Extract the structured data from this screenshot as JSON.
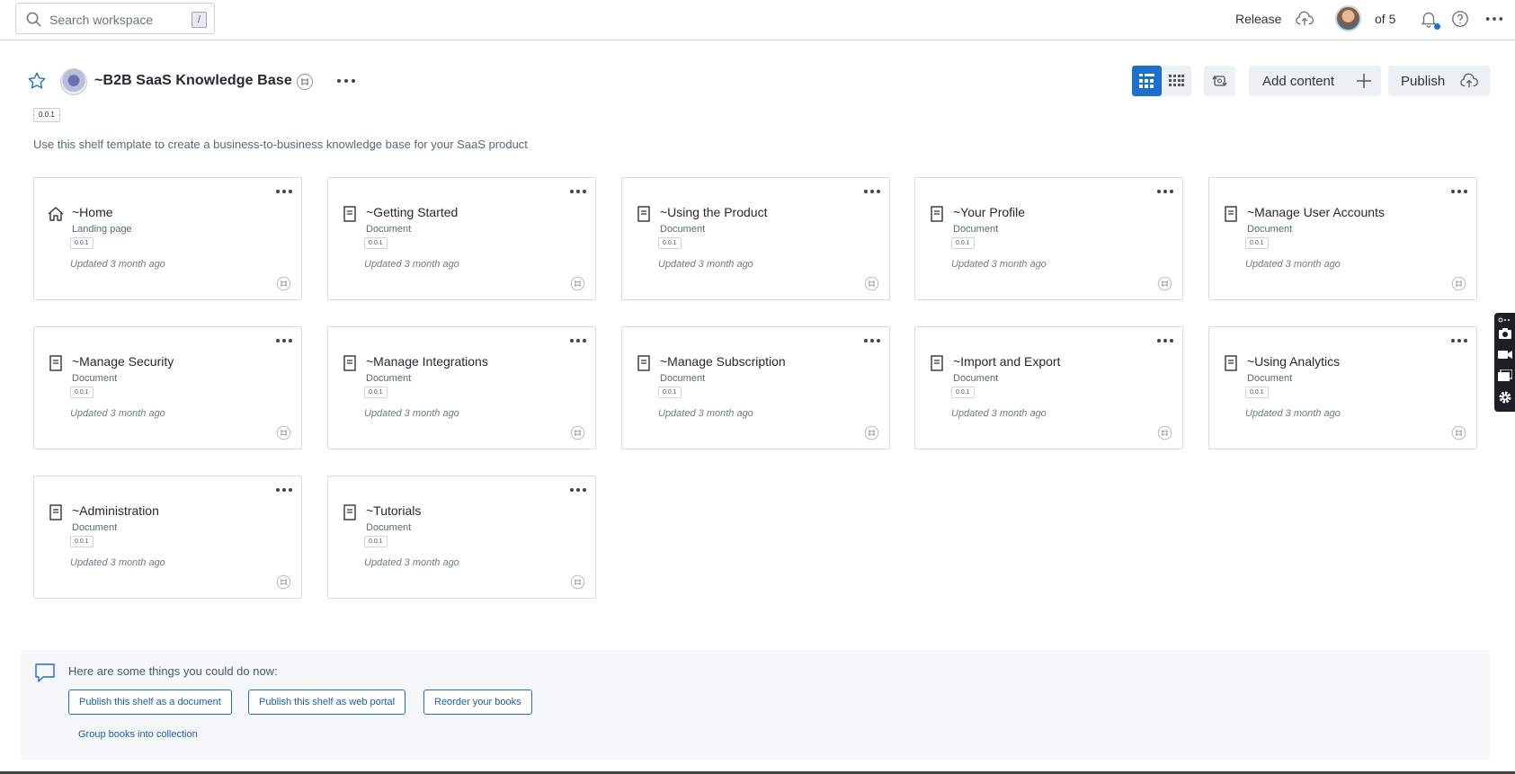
{
  "topbar": {
    "search_placeholder": "Search workspace",
    "search_shortcut": "/",
    "release_label": "Release",
    "of_label": "of 5"
  },
  "header": {
    "title": "~B2B SaaS Knowledge Base",
    "version": "0.0.1",
    "description": "Use this shelf template to create a business-to-business knowledge base for your SaaS product",
    "add_content_label": "Add content",
    "publish_label": "Publish"
  },
  "cards": [
    {
      "title": "~Home",
      "type": "Landing page",
      "version": "0.0.1",
      "updated": "Updated 3 month ago",
      "icon": "home-icon"
    },
    {
      "title": "~Getting Started",
      "type": "Document",
      "version": "0.0.1",
      "updated": "Updated 3 month ago",
      "icon": "document-icon"
    },
    {
      "title": "~Using the Product",
      "type": "Document",
      "version": "0.0.1",
      "updated": "Updated 3 month ago",
      "icon": "document-icon"
    },
    {
      "title": "~Your Profile",
      "type": "Document",
      "version": "0.0.1",
      "updated": "Updated 3 month ago",
      "icon": "document-icon"
    },
    {
      "title": "~Manage User Accounts",
      "type": "Document",
      "version": "0.0.1",
      "updated": "Updated 3 month ago",
      "icon": "document-icon"
    },
    {
      "title": "~Manage Security",
      "type": "Document",
      "version": "0.0.1",
      "updated": "Updated 3 month ago",
      "icon": "document-icon"
    },
    {
      "title": "~Manage Integrations",
      "type": "Document",
      "version": "0.0.1",
      "updated": "Updated 3 month ago",
      "icon": "document-icon"
    },
    {
      "title": "~Manage Subscription",
      "type": "Document",
      "version": "0.0.1",
      "updated": "Updated 3 month ago",
      "icon": "document-icon"
    },
    {
      "title": "~Import and Export",
      "type": "Document",
      "version": "0.0.1",
      "updated": "Updated 3 month ago",
      "icon": "document-icon"
    },
    {
      "title": "~Using Analytics",
      "type": "Document",
      "version": "0.0.1",
      "updated": "Updated 3 month ago",
      "icon": "document-icon"
    },
    {
      "title": "~Administration",
      "type": "Document",
      "version": "0.0.1",
      "updated": "Updated 3 month ago",
      "icon": "document-icon"
    },
    {
      "title": "~Tutorials",
      "type": "Document",
      "version": "0.0.1",
      "updated": "Updated 3 month ago",
      "icon": "document-icon"
    }
  ],
  "suggestions": {
    "heading": "Here are some things you could do now:",
    "buttons": [
      "Publish this shelf as a document",
      "Publish this shelf as web portal",
      "Reorder your books"
    ],
    "link": "Group books into collection"
  },
  "colors": {
    "accent": "#1b6fd1",
    "border": "#d8dde3",
    "muted_bg": "#eef1f4"
  }
}
